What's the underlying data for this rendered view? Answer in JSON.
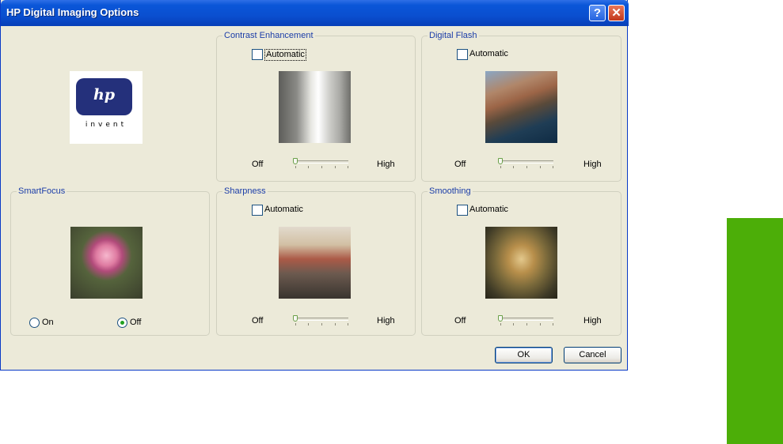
{
  "window": {
    "title": "HP Digital Imaging Options",
    "help_glyph": "?",
    "close_glyph": "✕"
  },
  "logo": {
    "brand": "hp",
    "tagline": "invent"
  },
  "contrast": {
    "legend": "Contrast Enhancement",
    "automatic_label": "Automatic",
    "automatic_checked": false,
    "slider_min_label": "Off",
    "slider_max_label": "High",
    "slider_value": 0
  },
  "flash": {
    "legend": "Digital Flash",
    "automatic_label": "Automatic",
    "automatic_checked": false,
    "slider_min_label": "Off",
    "slider_max_label": "High",
    "slider_value": 0
  },
  "smartfocus": {
    "legend": "SmartFocus",
    "on_label": "On",
    "off_label": "Off",
    "selected": "Off"
  },
  "sharpness": {
    "legend": "Sharpness",
    "automatic_label": "Automatic",
    "automatic_checked": false,
    "slider_min_label": "Off",
    "slider_max_label": "High",
    "slider_value": 0
  },
  "smoothing": {
    "legend": "Smoothing",
    "automatic_label": "Automatic",
    "automatic_checked": false,
    "slider_min_label": "Off",
    "slider_max_label": "High",
    "slider_value": 0
  },
  "buttons": {
    "ok": "OK",
    "cancel": "Cancel"
  },
  "colors": {
    "side_tab": "#4cae08",
    "titlebar": "#0a56d8",
    "dialog_bg": "#ecead9"
  }
}
